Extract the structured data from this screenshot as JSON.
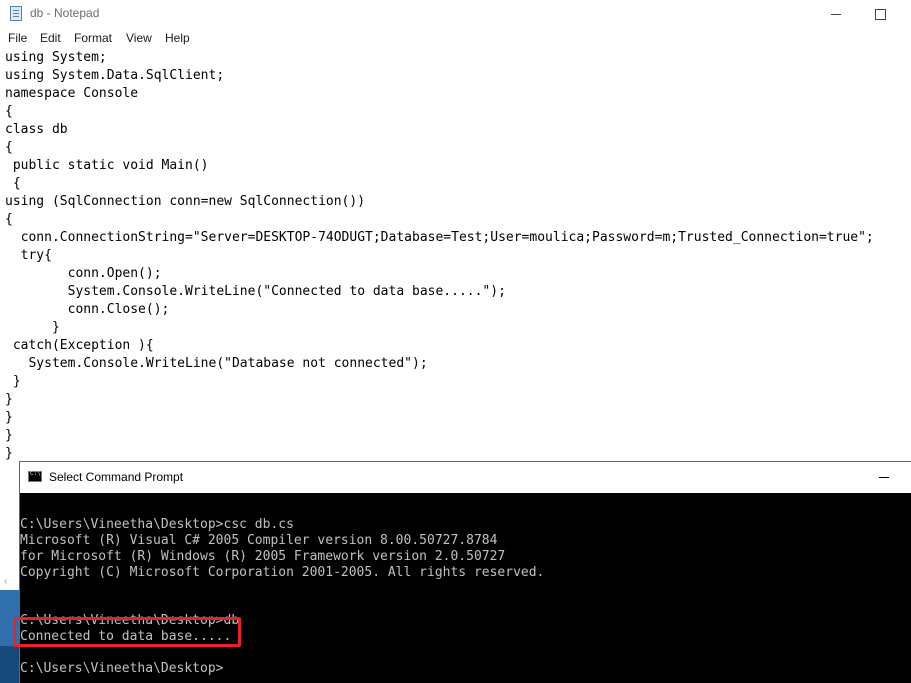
{
  "notepad": {
    "title": "db - Notepad",
    "menu": [
      "File",
      "Edit",
      "Format",
      "View",
      "Help"
    ],
    "code_lines": [
      "using System;",
      "using System.Data.SqlClient;",
      "namespace Console",
      "{",
      "class db",
      "{",
      " public static void Main()",
      " {",
      "using (SqlConnection conn=new SqlConnection())",
      "{",
      "  conn.ConnectionString=\"Server=DESKTOP-74ODUGT;Database=Test;User=moulica;Password=m;Trusted_Connection=true\";",
      "  try{",
      "        conn.Open();",
      "        System.Console.WriteLine(\"Connected to data base.....\");",
      "        conn.Close();",
      "      }",
      " catch(Exception ){",
      "   System.Console.WriteLine(\"Database not connected\");",
      " }",
      "}",
      "}",
      "}",
      "}"
    ],
    "scroll_arrow": "‹",
    "icons": {
      "app": "notepad-icon",
      "minimize": "minimize-icon",
      "maximize": "maximize-icon"
    }
  },
  "cmd": {
    "title": "Select Command Prompt",
    "lines": [
      "",
      "C:\\Users\\Vineetha\\Desktop>csc db.cs",
      "Microsoft (R) Visual C# 2005 Compiler version 8.00.50727.8784",
      "for Microsoft (R) Windows (R) 2005 Framework version 2.0.50727",
      "Copyright (C) Microsoft Corporation 2001-2005. All rights reserved.",
      "",
      "",
      "C:\\Users\\Vineetha\\Desktop>db",
      "Connected to data base.....",
      "",
      "C:\\Users\\Vineetha\\Desktop>"
    ],
    "highlight_color": "#e8212a"
  }
}
